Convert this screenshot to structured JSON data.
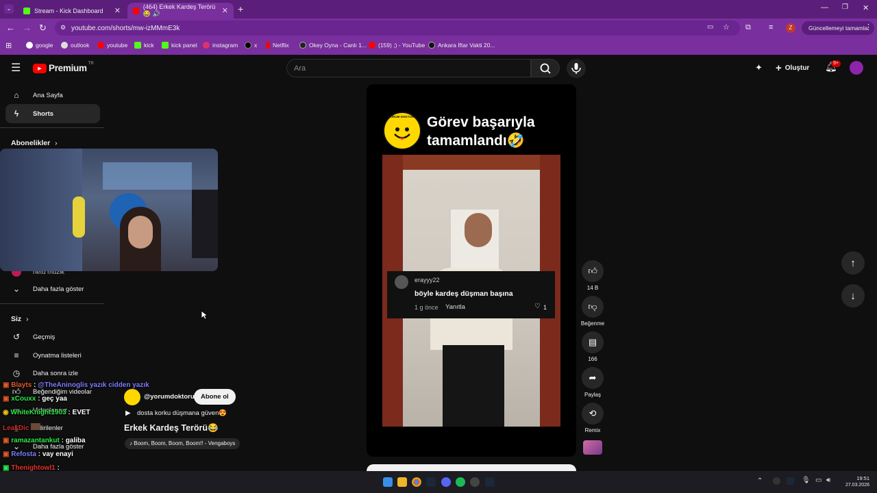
{
  "browser": {
    "tabs": [
      {
        "title": "Stream - Kick Dashboard",
        "favicon_color": "#53fc18"
      },
      {
        "title": "(464) Erkek Kardeş Terörü😂 🔊",
        "favicon_color": "#ff0000"
      }
    ],
    "url": "youtube.com/shorts/mw-izMMmE3k",
    "update_button": "Güncellemeyi tamamla",
    "profile_letter": "Z",
    "bookmarks": [
      {
        "label": "google",
        "color": "#4285f4"
      },
      {
        "label": "outlook",
        "color": "#dddddd"
      },
      {
        "label": "youtube",
        "color": "#ff0000"
      },
      {
        "label": "kick",
        "color": "#53fc18"
      },
      {
        "label": "kick panel",
        "color": "#53fc18"
      },
      {
        "label": "instagram",
        "color": "#e1306c"
      },
      {
        "label": "x",
        "color": "#000000"
      },
      {
        "label": "Netflix",
        "color": "#e50914"
      },
      {
        "label": "Okey Oyna - Canlı 1...",
        "color": "#222222"
      },
      {
        "label": "(159) ;) - YouTube",
        "color": "#ff0000"
      },
      {
        "label": "Ankara İftar Vakti 20...",
        "color": "#111111"
      }
    ]
  },
  "youtube": {
    "logo_text": "Premium",
    "logo_region": "TR",
    "search_placeholder": "Ara",
    "create_label": "Oluştur",
    "notifications_count": "9+",
    "sidebar": {
      "home": "Ana Sayfa",
      "shorts": "Shorts",
      "subscriptions_header": "Abonelikler",
      "hidden_item": "hetu müzik",
      "show_more": "Daha fazla göster",
      "you_header": "Siz",
      "history": "Geçmiş",
      "playlists": "Oynatma listeleri",
      "watch_later": "Daha sonra izle",
      "liked": "Beğendiğim videolar",
      "your_videos": "Videolarınız",
      "downloads": "İndirilenler",
      "show_more_2": "Daha fazla göster"
    },
    "short": {
      "overlay_title_line1": "Görev başarıyla",
      "overlay_title_line2": "tamamlandı🤣",
      "logo_text": "YORUM DOKTORU",
      "comment": {
        "user": "erayyy22",
        "text": "böyle kardeş düşman başına",
        "time": "1 g önce",
        "reply": "Yanıtla",
        "likes": "1"
      },
      "channel": "@yorumdoktoru",
      "subscribe": "Abone ol",
      "description": "dosta korku düşmana güven😍",
      "title": "Erkek Kardeş Terörü😂",
      "music": "Boom, Boom, Boom, Boom!! - Vengaboys"
    },
    "actions": {
      "likes": "14 B",
      "dislike": "Beğenme",
      "comments": "166",
      "share": "Paylaş",
      "remix": "Remix"
    }
  },
  "chat": [
    {
      "user": "Blayts",
      "user_color": "#e05a2a",
      "message": "@TheAninoglis yazık cidden yazık"
    },
    {
      "user": "xCouxx",
      "user_color": "#2ee84a",
      "message": "geç yaa"
    },
    {
      "user": "WhiteKnight1903",
      "user_color": "#2ee84a",
      "message": "EVET"
    },
    {
      "user": "LeakDic",
      "user_color": "#cc2a2a",
      "message": ""
    },
    {
      "user": "ramazantankut",
      "user_color": "#2ee84a",
      "message": "galiba"
    },
    {
      "user": "Refosta",
      "user_color": "#7c7cff",
      "message": "vay enayi"
    },
    {
      "user": "Thenightowl1",
      "user_color": "#e0342a",
      "message": ""
    }
  ],
  "taskbar": {
    "time": "19:51",
    "date": "27.03.2026"
  }
}
